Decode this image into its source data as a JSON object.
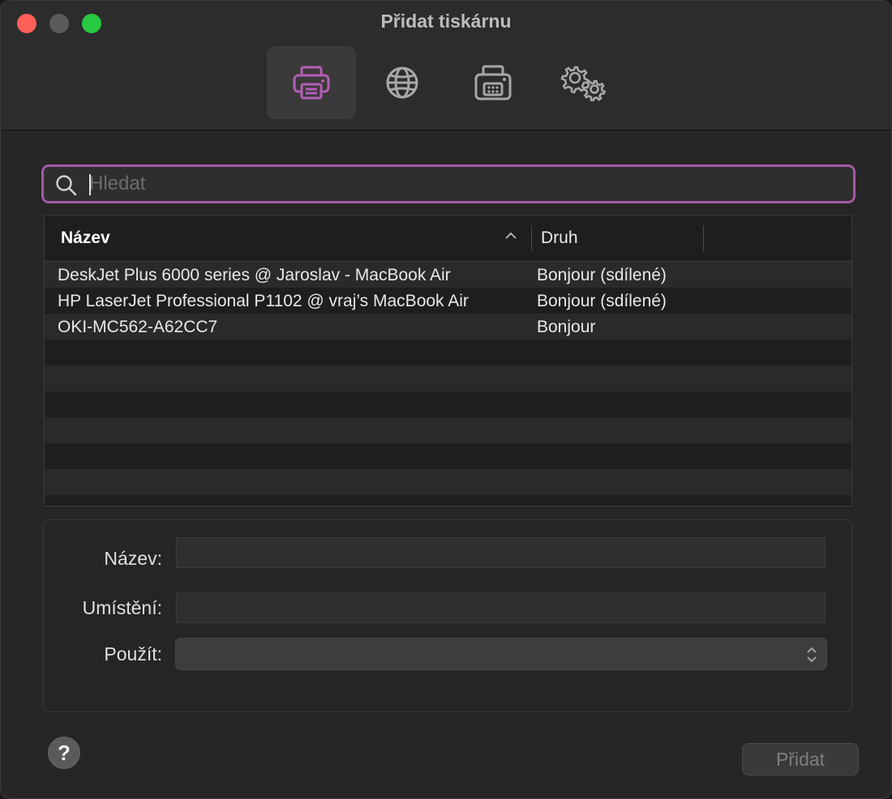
{
  "window": {
    "title": "Přidat tiskárnu"
  },
  "toolbar": {
    "items": [
      {
        "icon": "printer-icon",
        "active": true
      },
      {
        "icon": "globe-icon",
        "active": false
      },
      {
        "icon": "fax-icon",
        "active": false
      },
      {
        "icon": "gears-icon",
        "active": false
      }
    ],
    "accent_color": "#b25fb5"
  },
  "search": {
    "placeholder": "Hledat",
    "value": ""
  },
  "table": {
    "columns": [
      {
        "label": "Název",
        "sorted": "ascending"
      },
      {
        "label": "Druh"
      }
    ],
    "rows": [
      {
        "name": "DeskJet Plus 6000 series @ Jaroslav - MacBook Air",
        "kind": "Bonjour (sdílené)"
      },
      {
        "name": "HP LaserJet Professional P1102 @ vraj’s MacBook Air",
        "kind": "Bonjour (sdílené)"
      },
      {
        "name": "OKI-MC562-A62CC7",
        "kind": "Bonjour"
      }
    ]
  },
  "details": {
    "name_label": "Název:",
    "name_value": "",
    "location_label": "Umístění:",
    "location_value": "",
    "use_label": "Použít:",
    "use_value": ""
  },
  "footer": {
    "help_label": "?",
    "add_label": "Přidat"
  }
}
